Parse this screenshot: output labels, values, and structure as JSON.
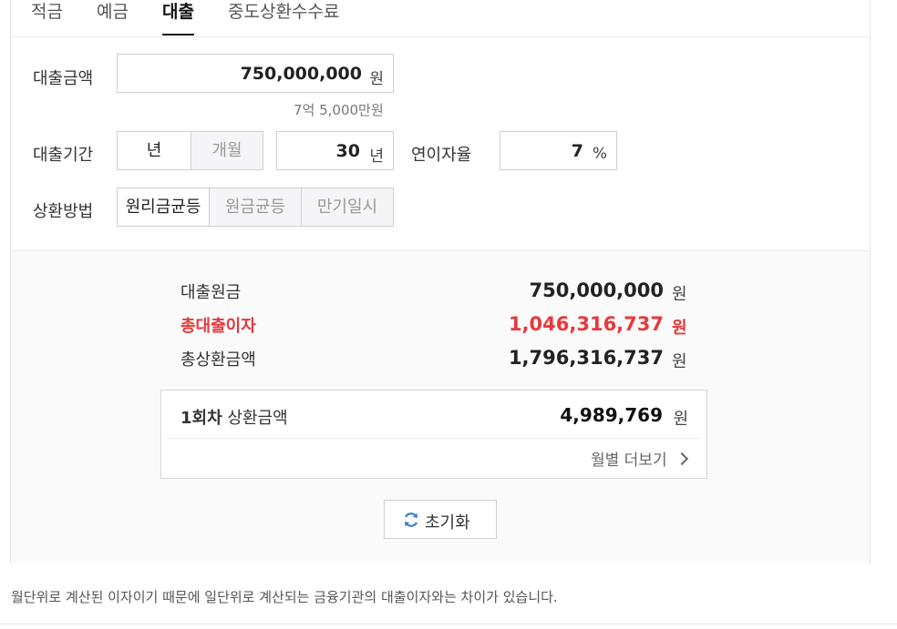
{
  "tabs": [
    {
      "label": "적금"
    },
    {
      "label": "예금"
    },
    {
      "label": "대출"
    },
    {
      "label": "중도상환수수료"
    }
  ],
  "form": {
    "amount_label": "대출금액",
    "amount_value": "750,000,000",
    "amount_unit": "원",
    "amount_hint": "7억 5,000만원",
    "period_label": "대출기간",
    "period_unit_year": "년",
    "period_unit_month": "개월",
    "period_value": "30",
    "period_value_unit": "년",
    "rate_label": "연이자율",
    "rate_value": "7",
    "rate_unit": "%",
    "method_label": "상환방법",
    "methods": [
      {
        "label": "원리금균등"
      },
      {
        "label": "원금균등"
      },
      {
        "label": "만기일시"
      }
    ]
  },
  "result": {
    "principal_label": "대출원금",
    "principal_value": "750,000,000",
    "interest_label": "총대출이자",
    "interest_value": "1,046,316,737",
    "total_label": "총상환금액",
    "total_value": "1,796,316,737",
    "unit": "원",
    "first_label_bold": "1회차",
    "first_label_rest": "상환금액",
    "first_value": "4,989,769",
    "monthly_more": "월별 더보기",
    "reset_label": "초기화"
  },
  "footnote": "월단위로 계산된 이자이기 때문에 일단위로 계산되는 금융기관의 대출이자와는 차이가 있습니다.",
  "colors": {
    "accent_red": "#e8383d",
    "reset_icon": "#3b7fd1"
  },
  "icons": [
    "chevron-right-icon",
    "refresh-icon"
  ]
}
